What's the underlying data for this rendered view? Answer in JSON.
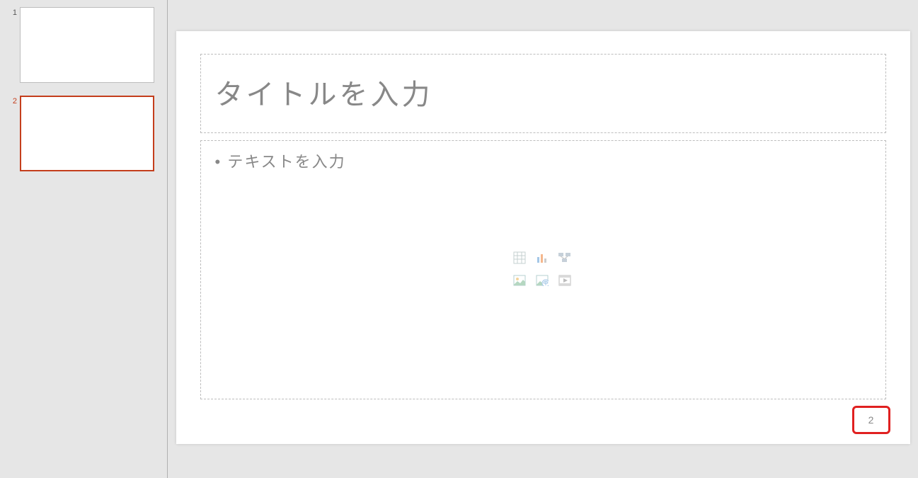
{
  "thumbnails": [
    {
      "number": "1",
      "active": false
    },
    {
      "number": "2",
      "active": true
    }
  ],
  "slide": {
    "title_placeholder": "タイトルを入力",
    "content_placeholder": "• テキストを入力",
    "page_number": "2",
    "content_icons": [
      "table-icon",
      "chart-icon",
      "smartart-icon",
      "picture-icon",
      "online-picture-icon",
      "video-icon"
    ]
  }
}
